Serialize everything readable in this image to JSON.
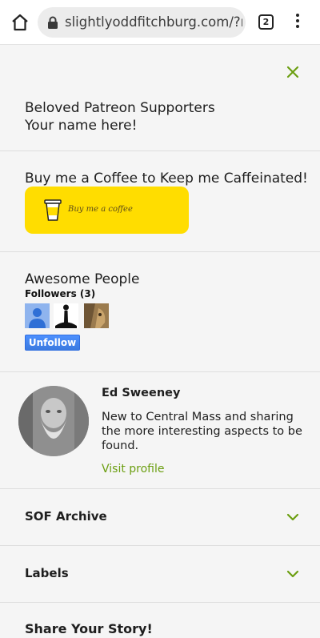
{
  "browser": {
    "url": "slightlyoddfitchburg.com/?m",
    "tab_count": "2",
    "icons": [
      "home-icon",
      "lock-icon",
      "tabs-icon",
      "more-vert-icon"
    ]
  },
  "sidebar": {
    "close_icon": "close-icon",
    "patreon": {
      "title": "Beloved Patreon Supporters",
      "text": "Your name here!"
    },
    "coffee": {
      "title": "Buy me a Coffee to Keep me Caffeinated!",
      "button_label": "Buy me a coffee",
      "button_color": "#ffdd00"
    },
    "followers": {
      "title": "Awesome People",
      "label": "Followers (3)",
      "button_label": "Unfollow"
    },
    "profile": {
      "name": "Ed Sweeney",
      "bio": "New to Central Mass and sharing the more interesting aspects to be found.",
      "link_label": "Visit profile"
    },
    "archive": {
      "title": "SOF Archive"
    },
    "labels": {
      "title": "Labels"
    },
    "story": {
      "title": "Share Your Story!"
    }
  },
  "colors": {
    "accent": "#6b9e10",
    "button_blue": "#4d90fe",
    "background": "#f5f5f5"
  }
}
